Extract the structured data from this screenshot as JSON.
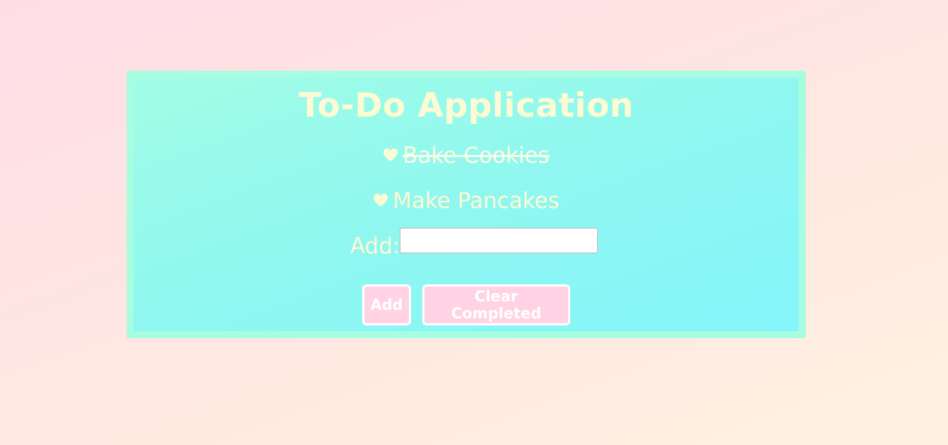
{
  "app": {
    "title": "To-Do Application"
  },
  "todos": [
    {
      "text": "Bake Cookies",
      "completed": true
    },
    {
      "text": "Make Pancakes",
      "completed": false
    }
  ],
  "add_form": {
    "label": "Add:",
    "input_value": "",
    "input_placeholder": ""
  },
  "buttons": {
    "add_label": "Add",
    "clear_label": "Clear Completed"
  },
  "icons": {
    "todo_marker": "heart-icon"
  },
  "colors": {
    "card_border": "#a6fde0",
    "text": "#fdfbd3",
    "button_bg": "#ffd3e4",
    "button_border": "#ffffff"
  }
}
